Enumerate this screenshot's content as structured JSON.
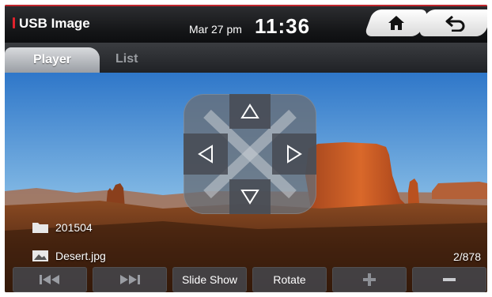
{
  "header": {
    "title": "USB Image",
    "date": "Mar 27 pm",
    "time": "11:36",
    "home_icon": "home-icon",
    "back_icon": "back-arrow-icon"
  },
  "tabs": [
    {
      "label": "Player",
      "active": true
    },
    {
      "label": "List",
      "active": false
    }
  ],
  "viewer": {
    "image_description_icon": "desert-photo",
    "dpad": {
      "up": "up-arrow-icon",
      "down": "down-arrow-icon",
      "left": "left-arrow-icon",
      "right": "right-arrow-icon"
    },
    "folder": "201504",
    "file": "Desert.jpg",
    "counter": "2/878"
  },
  "controls": [
    {
      "label": "",
      "icon": "previous-icon"
    },
    {
      "label": "",
      "icon": "next-icon"
    },
    {
      "label": "Slide Show",
      "icon": ""
    },
    {
      "label": "Rotate",
      "icon": ""
    },
    {
      "label": "",
      "icon": "plus-icon"
    },
    {
      "label": "",
      "icon": "minus-icon"
    }
  ],
  "colors": {
    "accent": "#e0222c",
    "header": "#141517"
  }
}
